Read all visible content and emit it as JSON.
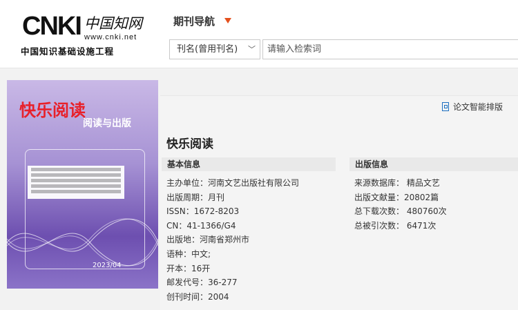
{
  "logo": {
    "brand": "CNKI",
    "cn_name": "中国知网",
    "url": "www.cnki.net",
    "subtitle": "中国知识基础设施工程"
  },
  "nav": {
    "title": "期刊导航",
    "search_field": "刊名(曾用刊名)",
    "search_placeholder": "请输入检索词"
  },
  "actions": {
    "smart_layout": "论文智能排版"
  },
  "cover": {
    "title": "快乐阅读",
    "subtitle": "阅读与出版",
    "issue": "2023/04"
  },
  "journal": {
    "title": "快乐阅读",
    "basic_info_heading": "基本信息",
    "publish_info_heading": "出版信息",
    "basic": [
      "主办单位：河南文艺出版社有限公司",
      "出版周期：月刊",
      "ISSN：1672-8203",
      "CN：41-1366/G4",
      "出版地：河南省郑州市",
      "语种：中文;",
      "开本：16开",
      "邮发代号：36-277",
      "创刊时间：2004"
    ],
    "publish": [
      "来源数据库： 精品文艺",
      "出版文献量：20802篇",
      "总下载次数： 480760次",
      "总被引次数： 6471次"
    ]
  },
  "colors": {
    "accent_arrow": "#e4501d",
    "link_blue": "#1a6ec0",
    "cover_purple": "#6d4fb0"
  }
}
